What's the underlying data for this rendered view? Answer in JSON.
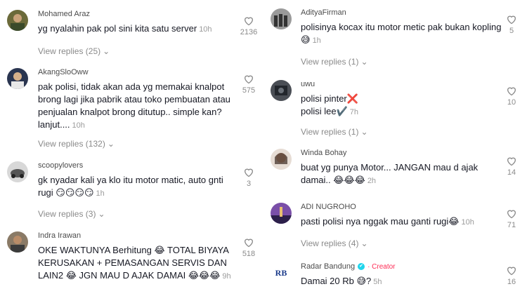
{
  "comments_left": [
    {
      "username": "Mohamed Araz",
      "text": "yg nyalahin pak pol sini kita satu server",
      "time": "10h",
      "likes": "2136",
      "replies": "View replies (25)"
    },
    {
      "username": "AkangSloOww",
      "text": "pak polisi, tidak akan ada yg memakai knalpot brong lagi jika pabrik atau toko pembuatan atau penjualan knalpot brong ditutup.. simple kan? lanjut....",
      "time": "10h",
      "likes": "575",
      "replies": "View replies (132)"
    },
    {
      "username": "scoopylovers",
      "text": "gk nyadar kali ya klo itu motor matic, auto gnti rugi 😏😏😏😏",
      "time": "1h",
      "likes": "3",
      "replies": "View replies (3)"
    },
    {
      "username": "Indra Irawan",
      "text": "OKE WAKTUNYA Berhitung 😂 TOTAL BIYAYA KERUSAKAN + PEMASANGAN SERVIS DAN LAIN2 😂 JGN MAU D AJAK DAMAI 😂😂😂",
      "time": "9h",
      "likes": "518",
      "replies": ""
    }
  ],
  "comments_right": [
    {
      "username": "AdityaFirman",
      "text": "polisinya kocax itu motor metic pak bukan kopling 😅",
      "time": "1h",
      "likes": "5",
      "replies": "View replies (1)"
    },
    {
      "username": "uwu",
      "text_lines": [
        "polisi pinter❌",
        "polisi lee✔️"
      ],
      "time": "7h",
      "likes": "10",
      "replies": "View replies (1)"
    },
    {
      "username": "Winda Bohay",
      "text": "buat yg punya Motor... JANGAN mau d ajak damai.. 😂😂😂",
      "time": "2h",
      "likes": "14",
      "replies": ""
    },
    {
      "username": "ADI NUGROHO",
      "text": "pasti polisi nya nggak mau ganti rugi😂",
      "time": "10h",
      "likes": "71",
      "replies": "View replies (4)"
    },
    {
      "username": "Radar Bandung",
      "badge": "✔",
      "creator_label": "· Creator",
      "text": "Damai 20 Rb 😅?",
      "time": "5h",
      "likes": "16",
      "replies": ""
    }
  ],
  "avatar_logo_text": "RB",
  "colors": {
    "text": "#161823",
    "muted": "#8a8a8a",
    "creator": "#fe2c55",
    "verified": "#20d5ec"
  }
}
